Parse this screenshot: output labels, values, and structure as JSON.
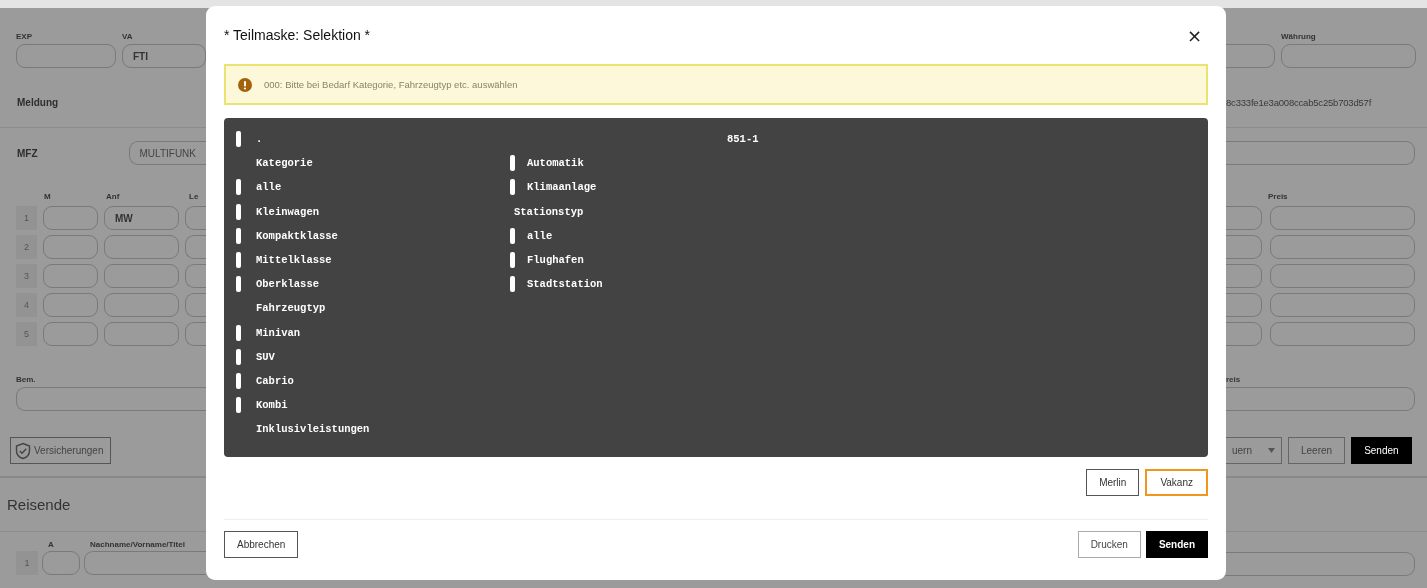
{
  "background": {
    "left": {
      "header_fields": [
        {
          "label": "EXP"
        },
        {
          "label": "VA",
          "value": "FTI"
        }
      ],
      "meldung_label": "Meldung",
      "mfz_label": "MFZ",
      "mfz_value": "MULTIFUNK",
      "table_columns": [
        "M",
        "Anf",
        "Le"
      ],
      "table_rows": [
        {
          "number": "1",
          "anf": "MW"
        },
        {
          "number": "2"
        },
        {
          "number": "3"
        },
        {
          "number": "4"
        },
        {
          "number": "5"
        }
      ],
      "bem_label": "Bem.",
      "insurance_button": "Versicherungen",
      "section_title": "Reisende",
      "traveler_columns": [
        "A",
        "Nachname/Vorname/Titel"
      ],
      "traveler_rows": [
        {
          "number": "1"
        }
      ]
    },
    "right": {
      "currency_label": "Währung",
      "hash": "8c333fe1e3a008ccab5c25b703d57f",
      "price_label": "Preis",
      "total_price_label": "reis",
      "dropdown_value": "uern",
      "buttons": [
        {
          "label": "Leeren",
          "kind": "outline"
        },
        {
          "label": "Senden",
          "kind": "primary"
        }
      ]
    }
  },
  "modal": {
    "title": "* Teilmaske: Selektion *",
    "close": "×",
    "alert": "000: Bitte bei Bedarf Kategorie, Fahrzeugtyp etc. auswählen",
    "panel": {
      "header_item": {
        "kind": "checkbox",
        "label": ".",
        "checked": false
      },
      "code": "851-1",
      "columns": [
        [
          {
            "kind": "heading",
            "label": "Kategorie"
          },
          {
            "kind": "checkbox",
            "label": "alle",
            "checked": false
          },
          {
            "kind": "checkbox",
            "label": "Kleinwagen",
            "checked": false
          },
          {
            "kind": "checkbox",
            "label": "Kompaktklasse",
            "checked": false
          },
          {
            "kind": "checkbox",
            "label": "Mittelklasse",
            "checked": false
          },
          {
            "kind": "checkbox",
            "label": "Oberklasse",
            "checked": false
          },
          {
            "kind": "heading",
            "label": "Fahrzeugtyp"
          },
          {
            "kind": "checkbox",
            "label": "Minivan",
            "checked": false
          },
          {
            "kind": "checkbox",
            "label": "SUV",
            "checked": false
          },
          {
            "kind": "checkbox",
            "label": "Cabrio",
            "checked": false
          },
          {
            "kind": "checkbox",
            "label": "Kombi",
            "checked": false
          },
          {
            "kind": "heading",
            "label": "Inklusivleistungen"
          }
        ],
        [
          {
            "kind": "checkbox",
            "label": "Automatik",
            "checked": false
          },
          {
            "kind": "checkbox",
            "label": "Klimaanlage",
            "checked": false
          },
          {
            "kind": "heading",
            "label": "Stationstyp"
          },
          {
            "kind": "checkbox",
            "label": "alle",
            "checked": false
          },
          {
            "kind": "checkbox",
            "label": "Flughafen",
            "checked": false
          },
          {
            "kind": "checkbox",
            "label": "Stadtstation",
            "checked": false
          }
        ]
      ]
    },
    "action_buttons": [
      {
        "label": "Merlin",
        "focused": false
      },
      {
        "label": "Vakanz",
        "focused": true
      }
    ],
    "footer_left": "Abbrechen",
    "footer_buttons": [
      {
        "label": "Drucken",
        "kind": "outline"
      },
      {
        "label": "Senden",
        "kind": "primary"
      }
    ]
  }
}
